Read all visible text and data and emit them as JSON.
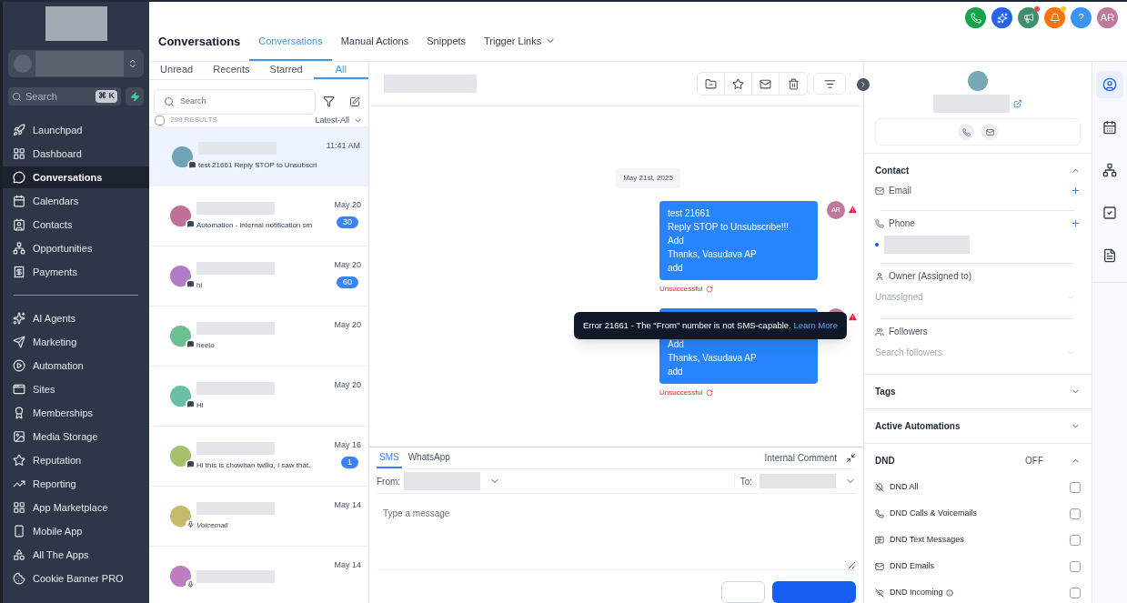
{
  "sidebar": {
    "search_placeholder": "Search",
    "shortcut": "⌘ K",
    "items": [
      {
        "label": "Launchpad",
        "kind": "rocket",
        "selected": false,
        "divider_before": false
      },
      {
        "label": "Dashboard",
        "kind": "grid",
        "selected": false,
        "divider_before": false
      },
      {
        "label": "Conversations",
        "kind": "chat",
        "selected": true,
        "divider_before": false
      },
      {
        "label": "Calendars",
        "kind": "calendar",
        "selected": false,
        "divider_before": false
      },
      {
        "label": "Contacts",
        "kind": "contact",
        "selected": false,
        "divider_before": false
      },
      {
        "label": "Opportunities",
        "kind": "network",
        "selected": false,
        "divider_before": false
      },
      {
        "label": "Payments",
        "kind": "receipt",
        "selected": false,
        "divider_before": false
      },
      {
        "label": "AI Agents",
        "kind": "sparkles",
        "selected": false,
        "divider_before": true
      },
      {
        "label": "Marketing",
        "kind": "send",
        "selected": false,
        "divider_before": false
      },
      {
        "label": "Automation",
        "kind": "play",
        "selected": false,
        "divider_before": false
      },
      {
        "label": "Sites",
        "kind": "window",
        "selected": false,
        "divider_before": false
      },
      {
        "label": "Memberships",
        "kind": "award",
        "selected": false,
        "divider_before": false
      },
      {
        "label": "Media Storage",
        "kind": "image",
        "selected": false,
        "divider_before": false
      },
      {
        "label": "Reputation",
        "kind": "star",
        "selected": false,
        "divider_before": false
      },
      {
        "label": "Reporting",
        "kind": "trend",
        "selected": false,
        "divider_before": false
      },
      {
        "label": "App Marketplace",
        "kind": "grid",
        "selected": false,
        "divider_before": false
      },
      {
        "label": "Mobile App",
        "kind": "phone",
        "selected": false,
        "divider_before": false
      },
      {
        "label": "All The Apps",
        "kind": "apps",
        "selected": false,
        "divider_before": false
      },
      {
        "label": "Cookie Banner PRO",
        "kind": "cookie",
        "selected": false,
        "divider_before": false
      }
    ]
  },
  "header": {
    "title": "Conversations",
    "tabs": [
      {
        "label": "Conversations",
        "selected": true,
        "dropdown": false
      },
      {
        "label": "Manual Actions",
        "selected": false,
        "dropdown": false
      },
      {
        "label": "Snippets",
        "selected": false,
        "dropdown": false
      },
      {
        "label": "Trigger Links",
        "selected": false,
        "dropdown": true
      }
    ],
    "actions": [
      {
        "kind": "phone",
        "color": "#16a34a"
      },
      {
        "kind": "sparkles",
        "color": "#2563eb"
      },
      {
        "kind": "megaphone",
        "color": "#3d8f6e",
        "badge": {
          "color": "#ef4444"
        }
      },
      {
        "kind": "bell",
        "color": "#f97316",
        "badge": {
          "color": "#facc15"
        }
      },
      {
        "kind": "help",
        "color": "#3b93f5",
        "text": "?"
      },
      {
        "kind": "avatar",
        "color": "#c0799a",
        "text": "AR"
      }
    ]
  },
  "list": {
    "tabs": [
      {
        "label": "Unread",
        "selected": false
      },
      {
        "label": "Recents",
        "selected": false
      },
      {
        "label": "Starred",
        "selected": false
      },
      {
        "label": "All",
        "selected": true
      }
    ],
    "search_placeholder": "Search",
    "select_all": {
      "checked": false
    },
    "results": "298 RESULTS",
    "sort": "Latest-All",
    "conversations": [
      {
        "time": "11:41 AM",
        "preview": "test 21661 Reply STOP to Unsubscri",
        "selected": true,
        "color": "#6fa3b5",
        "kind": "sms"
      },
      {
        "time": "May 20",
        "preview": "Automation - internal notification sm",
        "unread": "30",
        "selected": false,
        "color": "#c0709a",
        "kind": "sms"
      },
      {
        "time": "May 20",
        "preview": "hi",
        "unread": "60",
        "selected": false,
        "color": "#b07cc6",
        "kind": "sms"
      },
      {
        "time": "May 20",
        "preview": "heelo",
        "selected": false,
        "color": "#6cbf91",
        "kind": "sms"
      },
      {
        "time": "May 20",
        "preview": "Hi",
        "selected": false,
        "color": "#6bbfa6",
        "kind": "sms"
      },
      {
        "time": "May 16",
        "preview": "Hi this is chowhan twilio, I saw that.",
        "unread": "1",
        "selected": false,
        "color": "#a8bf6e",
        "kind": "sms"
      },
      {
        "time": "May 14",
        "preview": "Voicemail",
        "selected": false,
        "color": "#c4bb6e",
        "kind": "voicemail"
      },
      {
        "time": "May 14",
        "selected": false,
        "color": "#c07cc0",
        "kind": "voicemail"
      }
    ]
  },
  "chat": {
    "date": "May 21st, 2025",
    "avatar": "AR",
    "messages": [
      {
        "lines": [
          "test 21661",
          "Reply STOP to Unsubscribe!!!",
          "Add",
          "Thanks, Vasudava AP",
          "add"
        ],
        "status": "Unsuccessful",
        "failed": true
      },
      {
        "lines": [
          "Add",
          "Thanks, Vasudava AP",
          "add"
        ],
        "status": "Unsuccessful",
        "failed": true
      }
    ],
    "tooltip": {
      "text": "Error 21661 - The \"From\" number is not SMS-capable.",
      "link": "Learn More"
    }
  },
  "composer": {
    "tabs": [
      {
        "label": "SMS",
        "selected": true
      },
      {
        "label": "WhatsApp",
        "selected": false
      }
    ],
    "internal": "Internal Comment",
    "from": "From:",
    "to": "To:",
    "placeholder": "Type a message"
  },
  "contact": {
    "sections": [
      {
        "title": "Contact",
        "expanded": true,
        "fields": [
          {
            "kind": "email",
            "label": "Email",
            "addable": true
          },
          {
            "kind": "phone",
            "label": "Phone",
            "addable": true,
            "has_value": true
          },
          {
            "kind": "owner",
            "label": "Owner (Assigned to)",
            "placeholder": "Unassigned"
          },
          {
            "kind": "followers",
            "label": "Followers",
            "placeholder": "Search followers"
          }
        ]
      },
      {
        "title": "Tags",
        "expanded": false
      },
      {
        "title": "Active Automations",
        "expanded": false
      },
      {
        "title": "DND",
        "status": "OFF",
        "expanded": true,
        "options": [
          {
            "kind": "bell-off",
            "label": "DND All",
            "checked": false
          },
          {
            "kind": "phone",
            "label": "DND Calls & Voicemails",
            "checked": false
          },
          {
            "kind": "message",
            "label": "DND Text Messages",
            "checked": false
          },
          {
            "kind": "mail",
            "label": "DND Emails",
            "checked": false
          },
          {
            "kind": "wifi-off",
            "label": "DND Incoming",
            "checked": false,
            "info": true
          }
        ]
      }
    ]
  },
  "rail": [
    {
      "kind": "user",
      "selected": true
    },
    {
      "kind": "calendar",
      "selected": false
    },
    {
      "kind": "network",
      "selected": false
    },
    {
      "kind": "check",
      "selected": false
    },
    {
      "kind": "file",
      "selected": false
    }
  ]
}
